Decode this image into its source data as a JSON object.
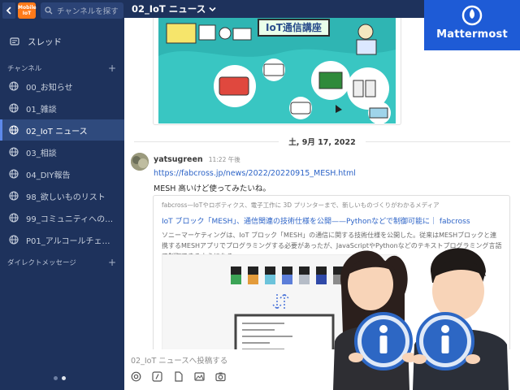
{
  "sidebar": {
    "team_label": "Mobile IoT",
    "search_placeholder": "チャンネルを探す",
    "threads_label": "スレッド",
    "channels_section": "チャンネル",
    "direct_section": "ダイレクトメッセージ",
    "channels": [
      {
        "label": "00_お知らせ",
        "active": false
      },
      {
        "label": "01_雑談",
        "active": false
      },
      {
        "label": "02_IoT ニュース",
        "active": true
      },
      {
        "label": "03_相談",
        "active": false
      },
      {
        "label": "04_DIY報告",
        "active": false
      },
      {
        "label": "98_欲しいものリスト",
        "active": false
      },
      {
        "label": "99_コミュニティへの…",
        "active": false
      },
      {
        "label": "P01_アルコールチェ…",
        "active": false
      }
    ]
  },
  "header": {
    "channel_title": "02_IoT ニュース"
  },
  "promo": {
    "banner_text": "IoT通信講座"
  },
  "date_separator": "土, 9月 17, 2022",
  "post": {
    "username": "yatsugreen",
    "time": "11:22 午後",
    "link": "https://fabcross.jp/news/2022/20220915_MESH.html",
    "message": "MESH 高いけど使ってみたいね。",
    "embed": {
      "site": "fabcross—IoTやロボティクス、電子工作に 3D プリンターまで、新しいものづくりがわかるメディア",
      "title": "IoT ブロック「MESH」、通信関連の技術仕様を公開——Pythonなどで制御可能に｜ fabcross",
      "description": "ソニーマーケティングは、IoT ブロック「MESH」の通信に関する技術仕様を公開した。従来はMESHブロックと連携するMESHアプリでプログラミングする必要があったが、JavaScriptやPythonなどのテキストプログラミング言語で制御できるようになる。"
    }
  },
  "composer": {
    "placeholder": "02_IoT ニュースへ投稿する"
  },
  "overlay": {
    "brand": "Mattermost"
  },
  "colors": {
    "sidebar": "#1e325c",
    "accent": "#1e5bd6",
    "link": "#2c63c7",
    "promo": "#39c6c2"
  }
}
